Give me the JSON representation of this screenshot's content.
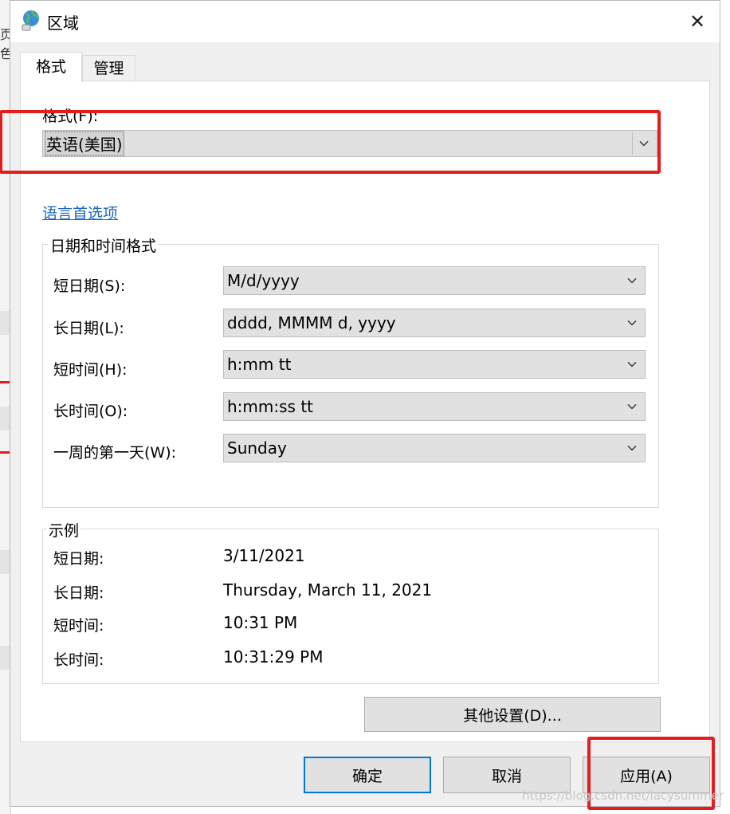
{
  "window": {
    "title": "区域",
    "close_symbol": "✕",
    "icon": "globe-icon"
  },
  "background": {
    "fragment_text": "页色"
  },
  "tabs": [
    {
      "label": "格式",
      "active": true
    },
    {
      "label": "管理",
      "active": false
    }
  ],
  "format": {
    "label": "格式(F):",
    "value": "英语(美国)"
  },
  "language_link": "语言首选项",
  "datetime_group": {
    "title": "日期和时间格式",
    "rows": [
      {
        "label": "短日期(S):",
        "value": "M/d/yyyy"
      },
      {
        "label": "长日期(L):",
        "value": "dddd, MMMM d, yyyy"
      },
      {
        "label": "短时间(H):",
        "value": "h:mm tt"
      },
      {
        "label": "长时间(O):",
        "value": "h:mm:ss tt"
      },
      {
        "label": "一周的第一天(W):",
        "value": "Sunday"
      }
    ]
  },
  "examples_group": {
    "title": "示例",
    "rows": [
      {
        "label": "短日期:",
        "value": "3/11/2021"
      },
      {
        "label": "长日期:",
        "value": "Thursday, March 11, 2021"
      },
      {
        "label": "短时间:",
        "value": "10:31 PM"
      },
      {
        "label": "长时间:",
        "value": "10:31:29 PM"
      }
    ]
  },
  "buttons": {
    "other_settings": "其他设置(D)...",
    "ok": "确定",
    "cancel": "取消",
    "apply": "应用(A)"
  },
  "watermark": "https://blog.csdn.net/lacysummer",
  "colors": {
    "highlight_box": "#e31c1c",
    "link": "#1a66c1",
    "default_button_border": "#0078d7"
  }
}
